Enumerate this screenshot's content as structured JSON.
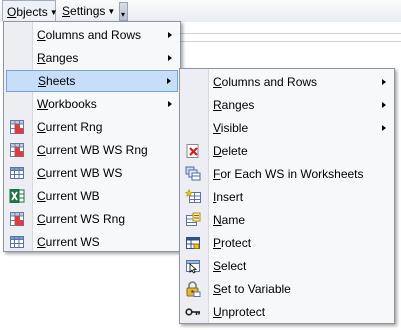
{
  "toolbar": {
    "objects_label": "Objects",
    "settings_label": "Settings"
  },
  "menu1": {
    "items": [
      {
        "label": "Columns and Rows",
        "submenu": true,
        "icon": null
      },
      {
        "label": "Ranges",
        "submenu": true,
        "icon": null
      },
      {
        "label": "Sheets",
        "submenu": true,
        "icon": null,
        "highlighted": true
      },
      {
        "label": "Workbooks",
        "submenu": true,
        "icon": null
      },
      {
        "label": "Current Rng",
        "submenu": false,
        "icon": "range-grid-icon"
      },
      {
        "label": "Current WB WS Rng",
        "submenu": false,
        "icon": "range-grid-icon"
      },
      {
        "label": "Current WB WS",
        "submenu": false,
        "icon": "sheet-grid-icon"
      },
      {
        "label": "Current WB",
        "submenu": false,
        "icon": "excel-icon"
      },
      {
        "label": "Current WS Rng",
        "submenu": false,
        "icon": "range-grid-icon"
      },
      {
        "label": "Current WS",
        "submenu": false,
        "icon": "sheet-grid-icon"
      }
    ]
  },
  "menu2": {
    "items": [
      {
        "label": "Columns and Rows",
        "submenu": true,
        "icon": null
      },
      {
        "label": "Ranges",
        "submenu": true,
        "icon": null
      },
      {
        "label": "Visible",
        "submenu": true,
        "icon": null
      },
      {
        "label": "Delete",
        "submenu": false,
        "icon": "delete-icon"
      },
      {
        "label": "For Each WS in Worksheets",
        "submenu": false,
        "icon": "loop-icon"
      },
      {
        "label": "Insert",
        "submenu": false,
        "icon": "insert-icon"
      },
      {
        "label": "Name",
        "submenu": false,
        "icon": "rename-icon"
      },
      {
        "label": "Protect",
        "submenu": false,
        "icon": "protect-icon"
      },
      {
        "label": "Select",
        "submenu": false,
        "icon": "select-icon"
      },
      {
        "label": "Set to Variable",
        "submenu": false,
        "icon": "lock-variable-icon"
      },
      {
        "label": "Unprotect",
        "submenu": false,
        "icon": "key-icon"
      }
    ]
  },
  "colors": {
    "highlight_bg": "#c6def7",
    "highlight_border": "#7da2ce",
    "menu_bg": "#f7f8fa"
  }
}
